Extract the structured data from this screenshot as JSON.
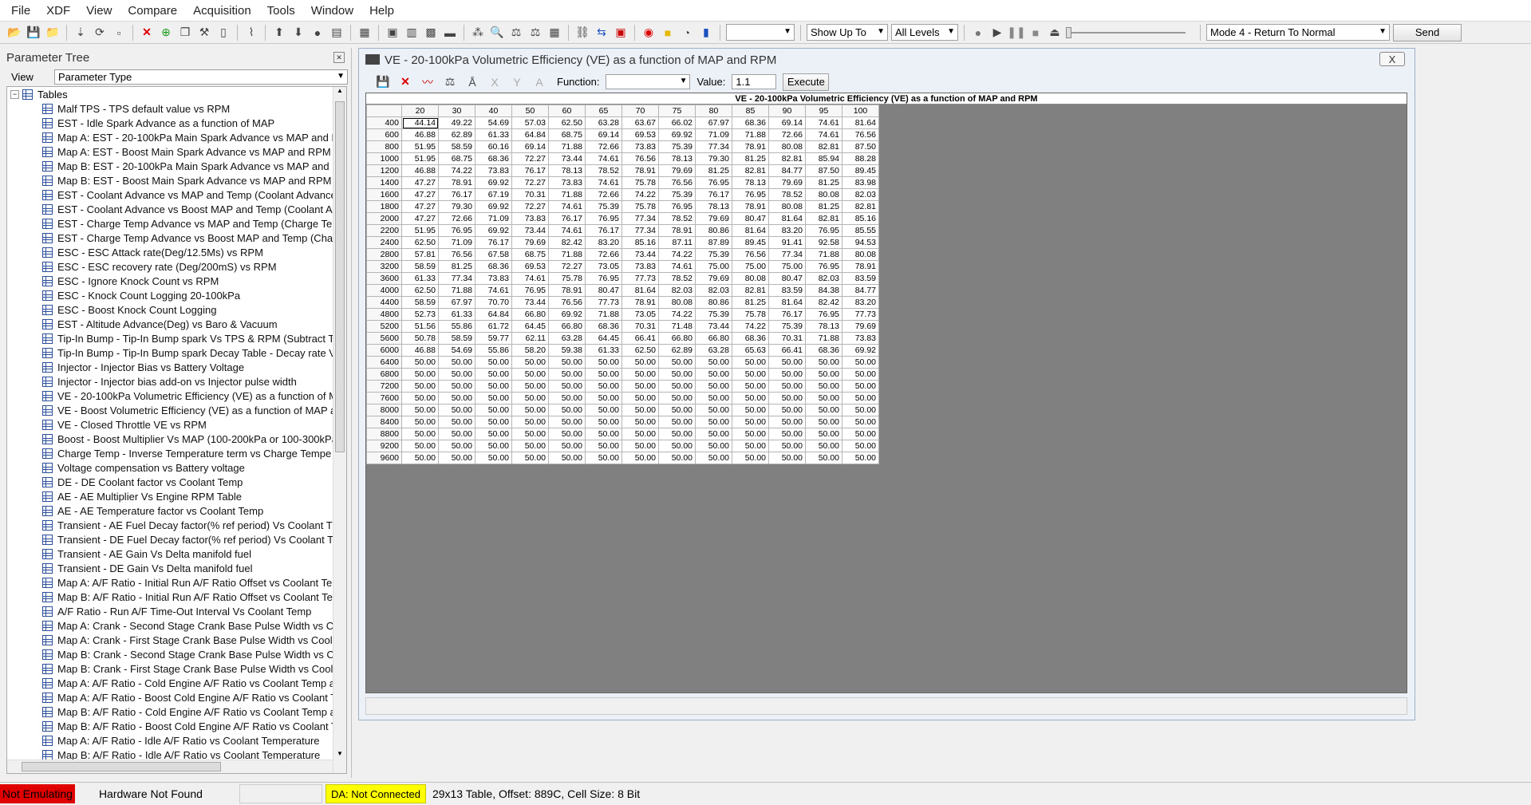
{
  "menu": [
    "File",
    "XDF",
    "View",
    "Compare",
    "Acquisition",
    "Tools",
    "Window",
    "Help"
  ],
  "toolbar": {
    "show_up_to": "Show Up To",
    "all_levels": "All Levels",
    "mode": "Mode 4 - Return To Normal",
    "send": "Send"
  },
  "left_panel": {
    "title": "Parameter Tree",
    "view_label": "View",
    "view_value": "Parameter Type",
    "root": "Tables",
    "items": [
      "Malf TPS - TPS default value vs RPM",
      "EST - Idle Spark Advance as a function of MAP",
      "Map A: EST - 20-100kPa Main Spark Advance vs MAP and RF",
      "Map A: EST - Boost Main Spark Advance vs MAP and RPM",
      "Map B: EST - 20-100kPa Main Spark Advance vs MAP and RF",
      "Map B: EST - Boost Main Spark Advance vs MAP and RPM",
      "EST - Coolant Advance vs MAP and Temp (Coolant Advance",
      "EST - Coolant Advance vs Boost MAP and Temp (Coolant Adv",
      "EST - Charge Temp Advance vs MAP and Temp (Charge Ter",
      "EST - Charge Temp Advance vs Boost MAP and Temp (Charg",
      "ESC - ESC Attack rate(Deg/12.5Ms) vs RPM",
      "ESC - ESC recovery rate (Deg/200mS) vs RPM",
      "ESC - Ignore Knock Count vs RPM",
      "ESC - Knock Count Logging 20-100kPa",
      "ESC - Boost Knock Count Logging",
      "EST - Altitude Advance(Deg) vs Baro & Vacuum",
      "Tip-In Bump - Tip-In Bump spark Vs TPS & RPM  (Subtract T",
      "Tip-In Bump - Tip-In Bump spark Decay Table - Decay rate V",
      "Injector - Injector Bias vs Battery Voltage",
      "Injector - Injector bias add-on vs Injector pulse width",
      "VE - 20-100kPa Volumetric Efficiency (VE) as a function of M",
      "VE - Boost Volumetric Efficiency (VE) as a function of MAP ar",
      "VE - Closed Throttle VE vs RPM",
      "Boost - Boost Multiplier Vs MAP (100-200kPa or 100-300kPa)",
      "Charge Temp - Inverse Temperature term vs Charge Tempe",
      "Voltage compensation vs Battery voltage",
      "DE - DE Coolant factor vs Coolant Temp",
      "AE - AE Multiplier Vs Engine RPM Table",
      "AE - AE Temperature factor vs Coolant Temp",
      "Transient - AE Fuel Decay factor(% ref period)  Vs Coolant T",
      "Transient - DE Fuel Decay factor(% ref period)  Vs Coolant T",
      "Transient - AE Gain Vs Delta manifold fuel",
      "Transient - DE Gain Vs Delta manifold fuel",
      "Map A: A/F Ratio - Initial Run A/F Ratio Offset vs Coolant Te",
      "Map B: A/F Ratio - Initial Run A/F Ratio Offset vs Coolant Ter",
      "A/F Ratio - Run A/F Time-Out Interval Vs Coolant Temp",
      "Map A: Crank - Second Stage Crank Base Pulse Width vs Coo",
      "Map A: Crank - First Stage Crank Base Pulse Width vs Coolar",
      "Map B: Crank - Second Stage Crank Base Pulse Width vs Coo",
      "Map B: Crank - First Stage Crank Base Pulse Width vs Coolar",
      "Map A: A/F Ratio - Cold Engine A/F Ratio vs Coolant Temp a",
      "Map A: A/F Ratio - Boost Cold Engine A/F Ratio vs Coolant T",
      "Map B: A/F Ratio - Cold Engine A/F Ratio vs Coolant Temp a",
      "Map B: A/F Ratio - Boost Cold Engine A/F Ratio vs Coolant T",
      "Map A: A/F Ratio - Idle A/F Ratio vs Coolant Temperature",
      "Map B: A/F Ratio - Idle A/F Ratio vs Coolant Temperature"
    ]
  },
  "child": {
    "title": "VE - 20-100kPa Volumetric Efficiency (VE) as a function of MAP and RPM",
    "close": "X",
    "function_label": "Function:",
    "value_label": "Value:",
    "value": "1.1",
    "execute": "Execute",
    "grid_title": "VE - 20-100kPa Volumetric Efficiency (VE) as a function of MAP and RPM",
    "columns": [
      "20",
      "30",
      "40",
      "50",
      "60",
      "65",
      "70",
      "75",
      "80",
      "85",
      "90",
      "95",
      "100"
    ],
    "rows": [
      {
        "rpm": "400",
        "v": [
          "44.14",
          "49.22",
          "54.69",
          "57.03",
          "62.50",
          "63.28",
          "63.67",
          "66.02",
          "67.97",
          "68.36",
          "69.14",
          "74.61",
          "81.64"
        ]
      },
      {
        "rpm": "600",
        "v": [
          "46.88",
          "62.89",
          "61.33",
          "64.84",
          "68.75",
          "69.14",
          "69.53",
          "69.92",
          "71.09",
          "71.88",
          "72.66",
          "74.61",
          "76.56"
        ]
      },
      {
        "rpm": "800",
        "v": [
          "51.95",
          "58.59",
          "60.16",
          "69.14",
          "71.88",
          "72.66",
          "73.83",
          "75.39",
          "77.34",
          "78.91",
          "80.08",
          "82.81",
          "87.50"
        ]
      },
      {
        "rpm": "1000",
        "v": [
          "51.95",
          "68.75",
          "68.36",
          "72.27",
          "73.44",
          "74.61",
          "76.56",
          "78.13",
          "79.30",
          "81.25",
          "82.81",
          "85.94",
          "88.28"
        ]
      },
      {
        "rpm": "1200",
        "v": [
          "46.88",
          "74.22",
          "73.83",
          "76.17",
          "78.13",
          "78.52",
          "78.91",
          "79.69",
          "81.25",
          "82.81",
          "84.77",
          "87.50",
          "89.45"
        ]
      },
      {
        "rpm": "1400",
        "v": [
          "47.27",
          "78.91",
          "69.92",
          "72.27",
          "73.83",
          "74.61",
          "75.78",
          "76.56",
          "76.95",
          "78.13",
          "79.69",
          "81.25",
          "83.98"
        ]
      },
      {
        "rpm": "1600",
        "v": [
          "47.27",
          "76.17",
          "67.19",
          "70.31",
          "71.88",
          "72.66",
          "74.22",
          "75.39",
          "76.17",
          "76.95",
          "78.52",
          "80.08",
          "82.03"
        ]
      },
      {
        "rpm": "1800",
        "v": [
          "47.27",
          "79.30",
          "69.92",
          "72.27",
          "74.61",
          "75.39",
          "75.78",
          "76.95",
          "78.13",
          "78.91",
          "80.08",
          "81.25",
          "82.81"
        ]
      },
      {
        "rpm": "2000",
        "v": [
          "47.27",
          "72.66",
          "71.09",
          "73.83",
          "76.17",
          "76.95",
          "77.34",
          "78.52",
          "79.69",
          "80.47",
          "81.64",
          "82.81",
          "85.16"
        ]
      },
      {
        "rpm": "2200",
        "v": [
          "51.95",
          "76.95",
          "69.92",
          "73.44",
          "74.61",
          "76.17",
          "77.34",
          "78.91",
          "80.86",
          "81.64",
          "83.20",
          "76.95",
          "85.55"
        ]
      },
      {
        "rpm": "2400",
        "v": [
          "62.50",
          "71.09",
          "76.17",
          "79.69",
          "82.42",
          "83.20",
          "85.16",
          "87.11",
          "87.89",
          "89.45",
          "91.41",
          "92.58",
          "94.53"
        ]
      },
      {
        "rpm": "2800",
        "v": [
          "57.81",
          "76.56",
          "67.58",
          "68.75",
          "71.88",
          "72.66",
          "73.44",
          "74.22",
          "75.39",
          "76.56",
          "77.34",
          "71.88",
          "80.08"
        ]
      },
      {
        "rpm": "3200",
        "v": [
          "58.59",
          "81.25",
          "68.36",
          "69.53",
          "72.27",
          "73.05",
          "73.83",
          "74.61",
          "75.00",
          "75.00",
          "75.00",
          "76.95",
          "78.91"
        ]
      },
      {
        "rpm": "3600",
        "v": [
          "61.33",
          "77.34",
          "73.83",
          "74.61",
          "75.78",
          "76.95",
          "77.73",
          "78.52",
          "79.69",
          "80.08",
          "80.47",
          "82.03",
          "83.59"
        ]
      },
      {
        "rpm": "4000",
        "v": [
          "62.50",
          "71.88",
          "74.61",
          "76.95",
          "78.91",
          "80.47",
          "81.64",
          "82.03",
          "82.03",
          "82.81",
          "83.59",
          "84.38",
          "84.77"
        ]
      },
      {
        "rpm": "4400",
        "v": [
          "58.59",
          "67.97",
          "70.70",
          "73.44",
          "76.56",
          "77.73",
          "78.91",
          "80.08",
          "80.86",
          "81.25",
          "81.64",
          "82.42",
          "83.20"
        ]
      },
      {
        "rpm": "4800",
        "v": [
          "52.73",
          "61.33",
          "64.84",
          "66.80",
          "69.92",
          "71.88",
          "73.05",
          "74.22",
          "75.39",
          "75.78",
          "76.17",
          "76.95",
          "77.73"
        ]
      },
      {
        "rpm": "5200",
        "v": [
          "51.56",
          "55.86",
          "61.72",
          "64.45",
          "66.80",
          "68.36",
          "70.31",
          "71.48",
          "73.44",
          "74.22",
          "75.39",
          "78.13",
          "79.69"
        ]
      },
      {
        "rpm": "5600",
        "v": [
          "50.78",
          "58.59",
          "59.77",
          "62.11",
          "63.28",
          "64.45",
          "66.41",
          "66.80",
          "66.80",
          "68.36",
          "70.31",
          "71.88",
          "73.83"
        ]
      },
      {
        "rpm": "6000",
        "v": [
          "46.88",
          "54.69",
          "55.86",
          "58.20",
          "59.38",
          "61.33",
          "62.50",
          "62.89",
          "63.28",
          "65.63",
          "66.41",
          "68.36",
          "69.92"
        ]
      },
      {
        "rpm": "6400",
        "v": [
          "50.00",
          "50.00",
          "50.00",
          "50.00",
          "50.00",
          "50.00",
          "50.00",
          "50.00",
          "50.00",
          "50.00",
          "50.00",
          "50.00",
          "50.00"
        ]
      },
      {
        "rpm": "6800",
        "v": [
          "50.00",
          "50.00",
          "50.00",
          "50.00",
          "50.00",
          "50.00",
          "50.00",
          "50.00",
          "50.00",
          "50.00",
          "50.00",
          "50.00",
          "50.00"
        ]
      },
      {
        "rpm": "7200",
        "v": [
          "50.00",
          "50.00",
          "50.00",
          "50.00",
          "50.00",
          "50.00",
          "50.00",
          "50.00",
          "50.00",
          "50.00",
          "50.00",
          "50.00",
          "50.00"
        ]
      },
      {
        "rpm": "7600",
        "v": [
          "50.00",
          "50.00",
          "50.00",
          "50.00",
          "50.00",
          "50.00",
          "50.00",
          "50.00",
          "50.00",
          "50.00",
          "50.00",
          "50.00",
          "50.00"
        ]
      },
      {
        "rpm": "8000",
        "v": [
          "50.00",
          "50.00",
          "50.00",
          "50.00",
          "50.00",
          "50.00",
          "50.00",
          "50.00",
          "50.00",
          "50.00",
          "50.00",
          "50.00",
          "50.00"
        ]
      },
      {
        "rpm": "8400",
        "v": [
          "50.00",
          "50.00",
          "50.00",
          "50.00",
          "50.00",
          "50.00",
          "50.00",
          "50.00",
          "50.00",
          "50.00",
          "50.00",
          "50.00",
          "50.00"
        ]
      },
      {
        "rpm": "8800",
        "v": [
          "50.00",
          "50.00",
          "50.00",
          "50.00",
          "50.00",
          "50.00",
          "50.00",
          "50.00",
          "50.00",
          "50.00",
          "50.00",
          "50.00",
          "50.00"
        ]
      },
      {
        "rpm": "9200",
        "v": [
          "50.00",
          "50.00",
          "50.00",
          "50.00",
          "50.00",
          "50.00",
          "50.00",
          "50.00",
          "50.00",
          "50.00",
          "50.00",
          "50.00",
          "50.00"
        ]
      },
      {
        "rpm": "9600",
        "v": [
          "50.00",
          "50.00",
          "50.00",
          "50.00",
          "50.00",
          "50.00",
          "50.00",
          "50.00",
          "50.00",
          "50.00",
          "50.00",
          "50.00",
          "50.00"
        ]
      }
    ]
  },
  "status": {
    "emulating": "Not Emulating",
    "hardware": "Hardware Not Found",
    "da": "DA: Not Connected",
    "info": "29x13 Table, Offset: 889C,  Cell Size: 8 Bit"
  }
}
